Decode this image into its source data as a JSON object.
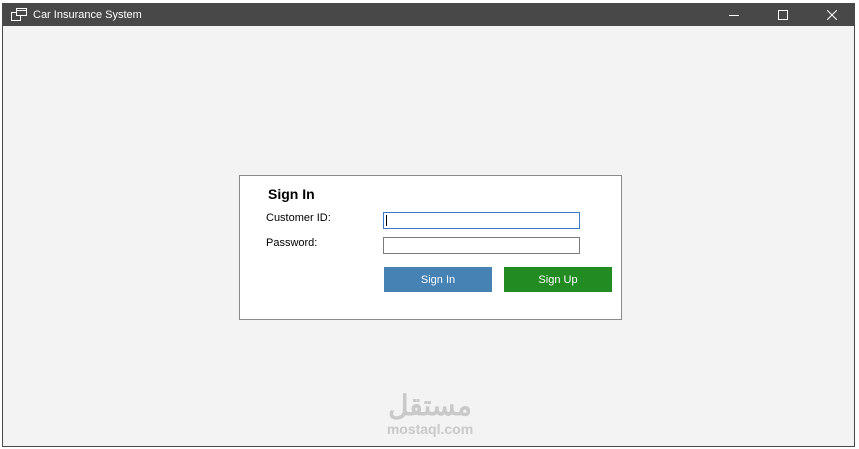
{
  "window": {
    "title": "Car Insurance System",
    "icon": "app-window-icon",
    "controls": {
      "minimize_icon": "minimize-icon",
      "maximize_icon": "maximize-icon",
      "close_icon": "close-icon"
    }
  },
  "signin_form": {
    "title": "Sign In",
    "customer_id_label": "Customer ID:",
    "customer_id_value": "",
    "password_label": "Password:",
    "password_value": "",
    "signin_button": "Sign In",
    "signup_button": "Sign Up"
  },
  "watermark": {
    "logo_text": "مستقل",
    "url_text": "mostaql.com"
  },
  "colors": {
    "titlebar": "#484848",
    "background": "#f3f3f3",
    "signin_button": "#4682b4",
    "signup_button": "#228b22",
    "focus_border": "#3a78c8"
  }
}
